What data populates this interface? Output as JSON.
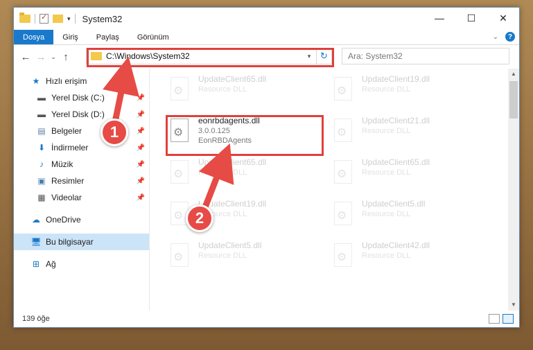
{
  "window": {
    "title": "System32",
    "controls": [
      "—",
      "☐",
      "✕"
    ]
  },
  "ribbon": {
    "tabs": [
      "Dosya",
      "Giriş",
      "Paylaş",
      "Görünüm"
    ],
    "help": "?"
  },
  "nav_buttons": {
    "back": "←",
    "forward": "→",
    "recent": "⌄",
    "up": "↑"
  },
  "address": {
    "path": "C:\\Windows\\System32",
    "refresh_icon": "↻"
  },
  "search": {
    "placeholder": "Ara: System32"
  },
  "sidebar": {
    "items": [
      {
        "label": "Hızlı erişim",
        "icon": "star-icon"
      },
      {
        "label": "Yerel Disk (C:)",
        "icon": "drive-icon",
        "pinned": true
      },
      {
        "label": "Yerel Disk (D:)",
        "icon": "drive-icon",
        "pinned": true
      },
      {
        "label": "Belgeler",
        "icon": "documents-icon",
        "pinned": true
      },
      {
        "label": "İndirmeler",
        "icon": "download-icon",
        "pinned": true
      },
      {
        "label": "Müzik",
        "icon": "music-icon",
        "pinned": true
      },
      {
        "label": "Resimler",
        "icon": "pictures-icon",
        "pinned": true
      },
      {
        "label": "Videolar",
        "icon": "videos-icon",
        "pinned": true
      },
      {
        "label": "OneDrive",
        "icon": "cloud-icon"
      },
      {
        "label": "Bu bilgisayar",
        "icon": "computer-icon",
        "selected": true
      },
      {
        "label": "Ağ",
        "icon": "network-icon"
      }
    ]
  },
  "files": [
    {
      "name": "UpdateClient65.dll",
      "sub1": "Resource DLL",
      "faded": true
    },
    {
      "name": "UpdateClient19.dll",
      "sub1": "Resource DLL",
      "faded": true
    },
    {
      "name": "eonrbdagents.dll",
      "sub1": "3.0.0.125",
      "sub2": "EonRBDAgents",
      "faded": false
    },
    {
      "name": "UpdateClient21.dll",
      "sub1": "Resource DLL",
      "faded": true
    },
    {
      "name": "UpdateClient65.dll",
      "sub1": "Resource DLL",
      "faded": true
    },
    {
      "name": "UpdateClient65.dll",
      "sub1": "Resource DLL",
      "faded": true
    },
    {
      "name": "UpdateClient19.dll",
      "sub1": "Resource DLL",
      "faded": true
    },
    {
      "name": "UpdateClient5.dll",
      "sub1": "Resource DLL",
      "faded": true
    },
    {
      "name": "UpdateClient5.dll",
      "sub1": "Resource DLL",
      "faded": true
    },
    {
      "name": "UpdateClient42.dll",
      "sub1": "Resource DLL",
      "faded": true
    }
  ],
  "status": {
    "count": "139 öğe"
  },
  "callouts": {
    "one": "1",
    "two": "2"
  },
  "colors": {
    "accent": "#1979ca",
    "highlight": "#e0403b",
    "selection": "#cce4f7"
  }
}
